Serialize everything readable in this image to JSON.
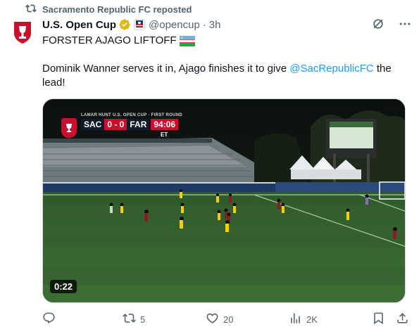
{
  "repost": {
    "text": "Sacramento Republic FC reposted"
  },
  "author": {
    "name": "U.S. Open Cup",
    "handle": "@opencup",
    "separator": "·",
    "time": "3h"
  },
  "tweet": {
    "line1": "FORSTER AJAGO LIFTOFF",
    "para2_before": "Dominik Wanner serves it in, Ajago finishes it to give ",
    "mention": "@SacRepublicFC",
    "para2_after": " the lead!"
  },
  "video": {
    "duration": "0:22",
    "scorebug": {
      "title": "LAMAR HUNT U.S. OPEN CUP · FIRST ROUND",
      "home": "SAC",
      "score": "0 - 0",
      "away": "FAR",
      "clock": "94:06",
      "period": "ET"
    }
  },
  "actions": {
    "replies": "",
    "reposts": "5",
    "likes": "20",
    "views": "2K"
  },
  "colors": {
    "accent": "#1d9bf0",
    "muted": "#536471",
    "verified_gold": "#e2b719",
    "brand_red": "#c8102e"
  },
  "icons": [
    "repost-icon",
    "verified-icon",
    "affiliate-badge-icon",
    "grok-icon",
    "more-icon",
    "flag-icon",
    "reply-icon",
    "like-icon",
    "views-icon",
    "bookmark-icon",
    "share-icon"
  ]
}
